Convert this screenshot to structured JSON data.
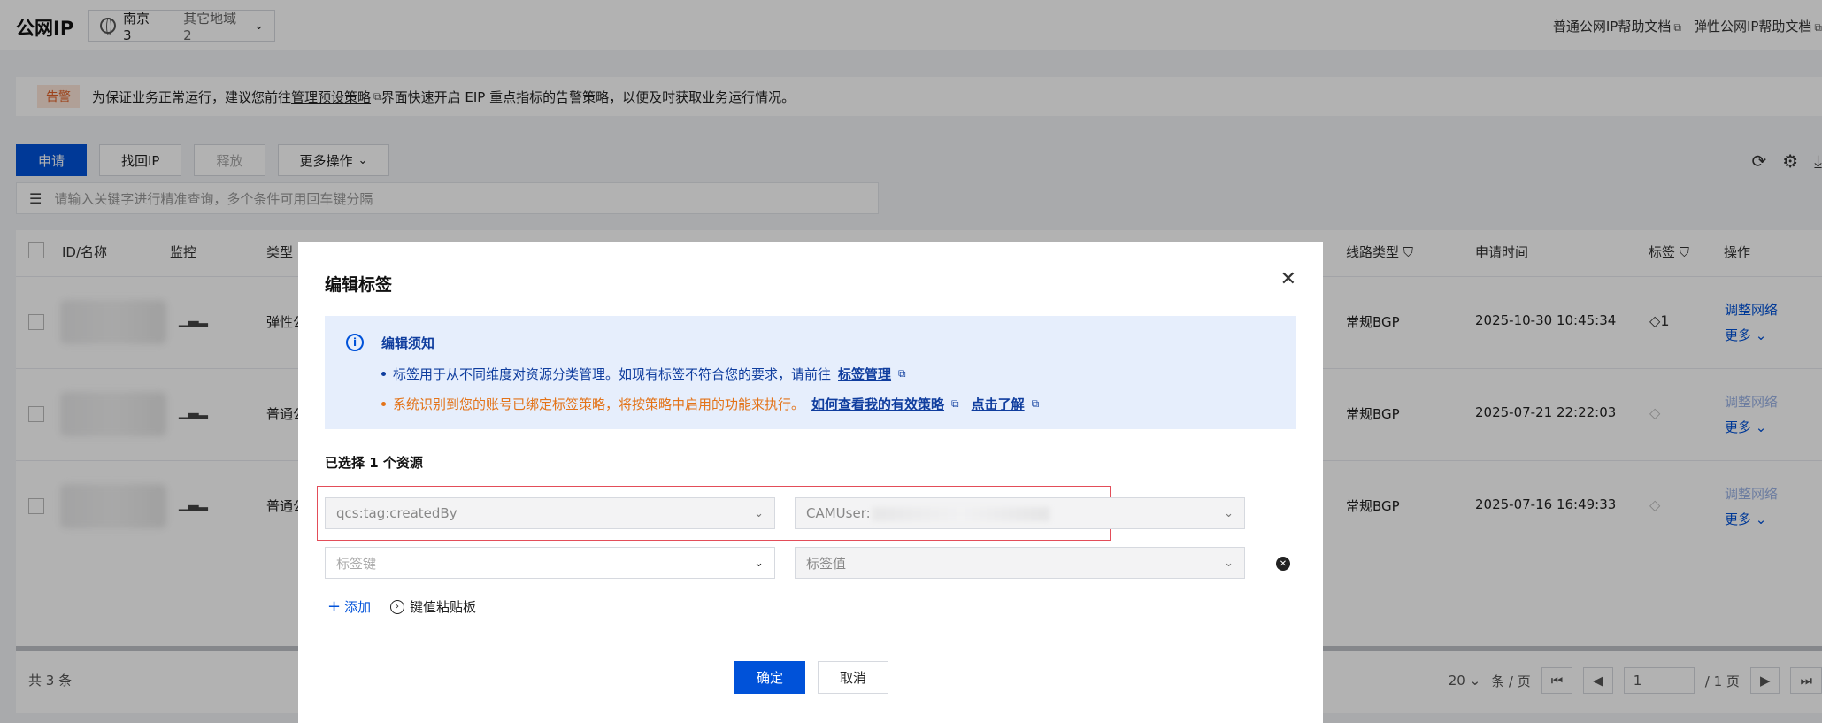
{
  "app": {
    "title": "公网IP",
    "region_selected": "南京 3",
    "region_other": "其它地域 2",
    "help_links": [
      "普通公网IP帮助文档",
      "弹性公网IP帮助文档"
    ]
  },
  "alert": {
    "tag": "告警",
    "text_before": "为保证业务正常运行，建议您前往",
    "link": "管理预设策略",
    "text_after": "界面快速开启 EIP 重点指标的告警策略，以便及时获取业务运行情况。"
  },
  "toolbar": {
    "apply": "申请",
    "retrieve": "找回IP",
    "release": "释放",
    "more_actions": "更多操作"
  },
  "search": {
    "placeholder": "请输入关键字进行精准查询，多个条件可用回车键分隔"
  },
  "table": {
    "headers": {
      "id_name": "ID/名称",
      "monitor": "监控",
      "type": "类型",
      "line_type": "线路类型",
      "apply_time": "申请时间",
      "tags": "标签",
      "actions": "操作"
    },
    "rows": [
      {
        "type": "弹性公",
        "line": "常规BGP",
        "time": "2025-10-30 10:45:34",
        "tag_count": "1",
        "op1": "调整网络",
        "op2": "更多"
      },
      {
        "type": "普通公",
        "line": "常规BGP",
        "time": "2025-07-21 22:22:03",
        "tag_count": "",
        "op1": "调整网络",
        "op2": "更多"
      },
      {
        "type": "普通公",
        "line": "常规BGP",
        "time": "2025-07-16 16:49:33",
        "tag_count": "",
        "op1": "调整网络",
        "op2": "更多"
      }
    ],
    "total": "共 3 条",
    "page_size": "20",
    "per_page": "条 / 页",
    "page_current": "1",
    "page_total": "/ 1 页"
  },
  "modal": {
    "title": "编辑标签",
    "notice_title": "编辑须知",
    "notice_line1": "标签用于从不同维度对资源分类管理。如现有标签不符合您的要求，请前往",
    "notice_line1_link": "标签管理",
    "notice_line2": "系统识别到您的账号已绑定标签策略，将按策略中启用的功能来执行。",
    "notice_line2_link1": "如何查看我的有效策略",
    "notice_line2_link2": "点击了解",
    "selected": "已选择 1 个资源",
    "tag_rows": [
      {
        "key": "qcs:tag:createdBy",
        "value": "CAMUser:"
      },
      {
        "key_placeholder": "标签键",
        "value_placeholder": "标签值"
      }
    ],
    "add": "添加",
    "paste": "键值粘贴板",
    "confirm": "确定",
    "cancel": "取消"
  },
  "colors": {
    "primary": "#0052d9",
    "warning": "#e37318",
    "highlight_box": "#e34d59"
  }
}
